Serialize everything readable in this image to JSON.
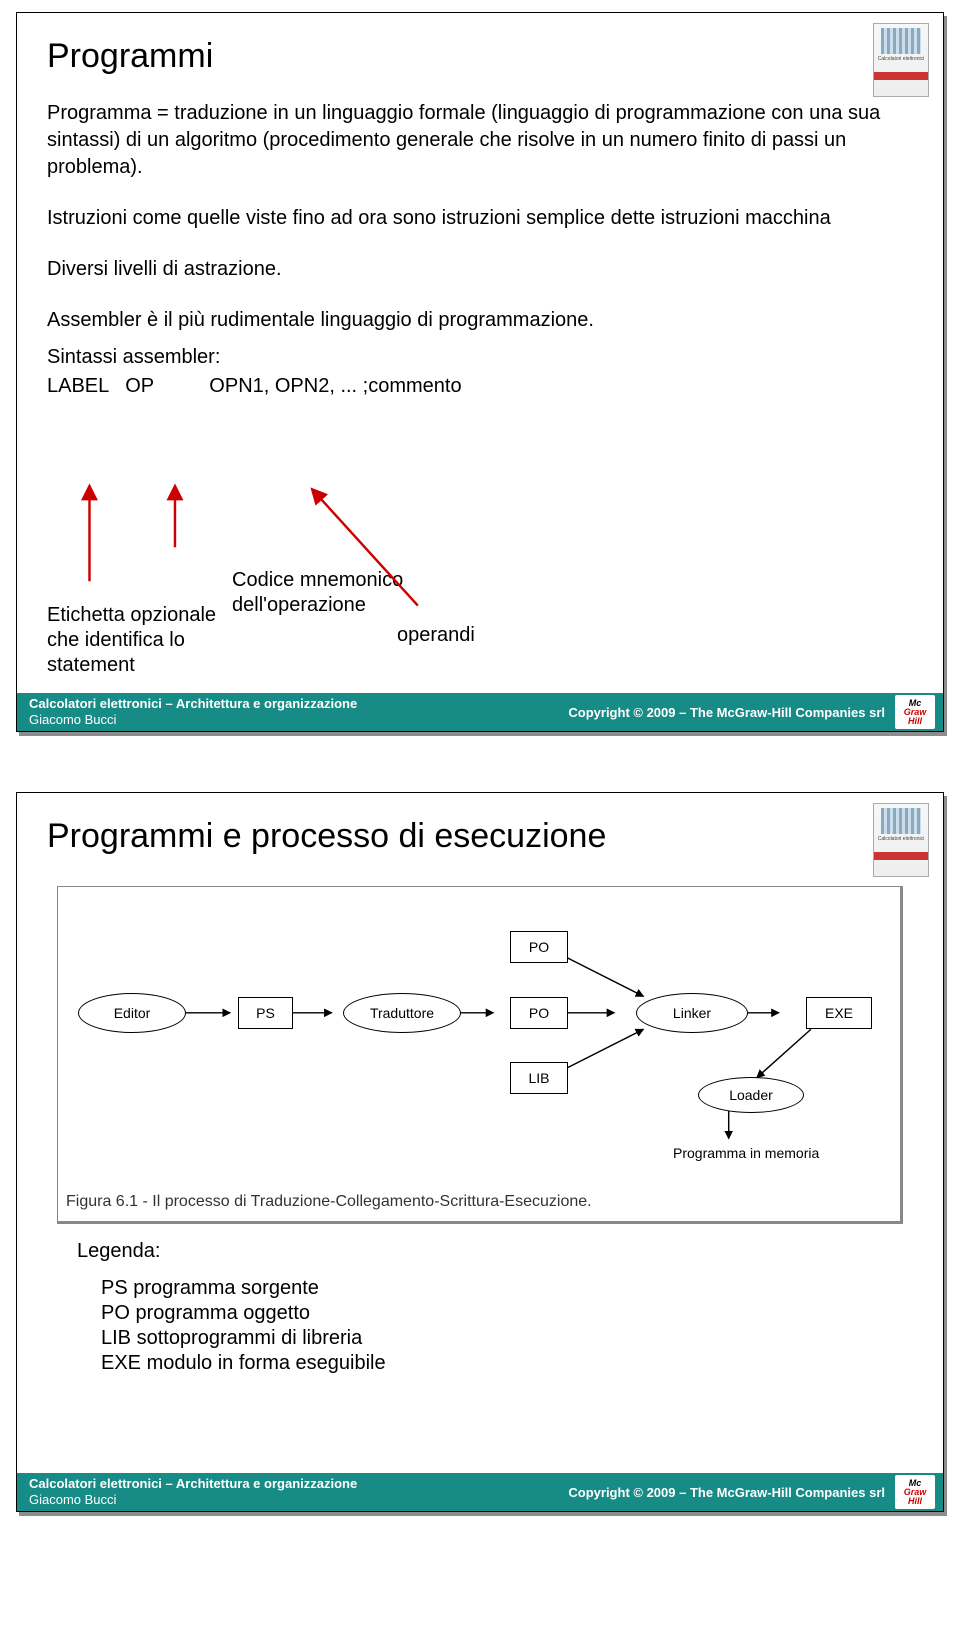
{
  "slide1": {
    "title": "Programmi",
    "p1": "Programma = traduzione in un linguaggio formale (linguaggio di programmazione con una sua sintassi) di un algoritmo (procedimento generale che risolve in un numero finito di passi un problema).",
    "p2": "Istruzioni come quelle viste fino ad ora sono istruzioni semplice dette istruzioni macchina",
    "p3": "Diversi livelli di astrazione.",
    "p4": "Assembler è il più rudimentale linguaggio di programmazione.",
    "p5": "Sintassi assembler:",
    "syntax": "LABEL   OP          OPN1, OPN2, ... ;commento",
    "ann_label": "Etichetta opzionale\nche identifica lo\nstatement",
    "ann_mnem": "Codice mnemonico\ndell'operazione",
    "ann_oper": "operandi"
  },
  "slide2": {
    "title": "Programmi e processo di esecuzione",
    "nodes": {
      "editor": "Editor",
      "ps": "PS",
      "traduttore": "Traduttore",
      "po1": "PO",
      "po2": "PO",
      "lib": "LIB",
      "linker": "Linker",
      "exe": "EXE",
      "loader": "Loader",
      "mem": "Programma in memoria"
    },
    "caption": "Figura 6.1 - Il processo di Traduzione-Collegamento-Scrittura-Esecuzione.",
    "legend_title": "Legenda:",
    "legend": [
      "PS programma sorgente",
      "PO programma oggetto",
      "LIB sottoprogrammi di libreria",
      "EXE modulo in forma eseguibile"
    ]
  },
  "footer": {
    "line1": "Calcolatori elettronici – Architettura e organizzazione",
    "line2": "Giacomo Bucci",
    "copyright": "Copyright © 2009 – The McGraw-Hill Companies srl"
  }
}
